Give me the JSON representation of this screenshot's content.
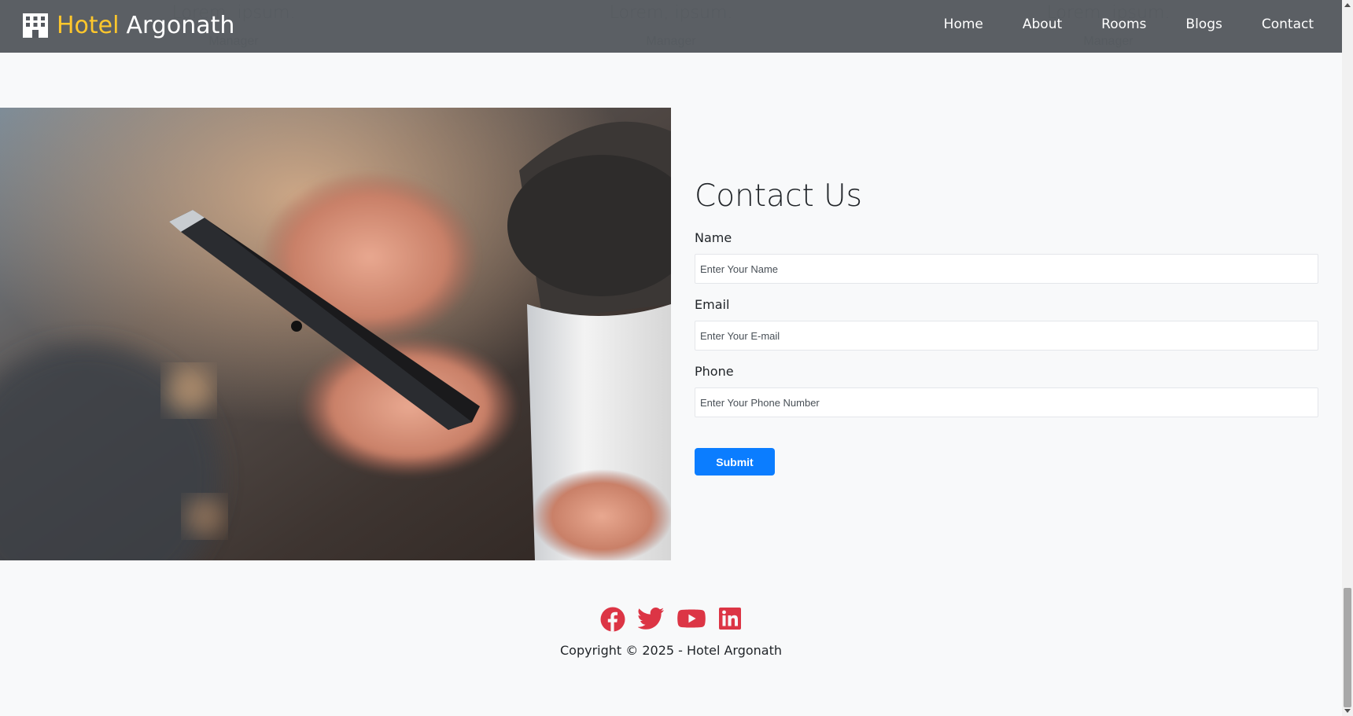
{
  "team_ghost": [
    {
      "name": "Lorem, ipsum.",
      "role": "Manager"
    },
    {
      "name": "Lorem, ipsum.",
      "role": "Manager"
    },
    {
      "name": "Lorem, ipsum.",
      "role": "Manager"
    }
  ],
  "navbar": {
    "brand_accent": "Hotel",
    "brand_name": "Argonath",
    "links": [
      "Home",
      "About",
      "Rooms",
      "Blogs",
      "Contact"
    ]
  },
  "contact": {
    "title": "Contact Us",
    "fields": [
      {
        "label": "Name",
        "placeholder": "Enter Your Name"
      },
      {
        "label": "Email",
        "placeholder": "Enter Your E-mail"
      },
      {
        "label": "Phone",
        "placeholder": "Enter Your Phone Number"
      }
    ],
    "submit_label": "Submit"
  },
  "footer": {
    "social_icons": [
      "facebook-icon",
      "twitter-icon",
      "youtube-icon",
      "linkedin-icon"
    ],
    "copyright": "Copyright © 2025 - Hotel Argonath"
  },
  "colors": {
    "accent": "#ffc72c",
    "primary_button": "#0b7dff",
    "social_icon": "#dc3545",
    "navbar_bg": "#54585e",
    "page_bg": "#f8f9fa"
  }
}
